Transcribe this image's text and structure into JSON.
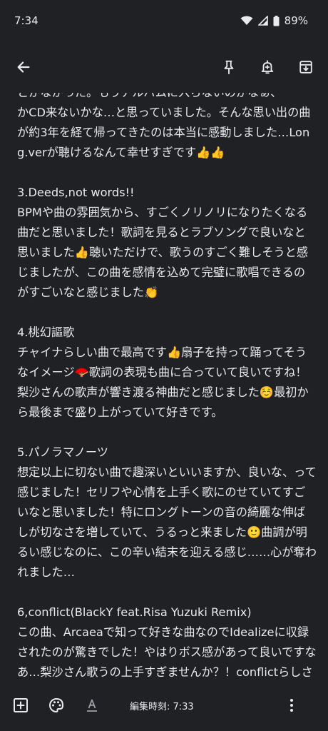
{
  "status": {
    "time": "7:34",
    "battery": "89%"
  },
  "note": {
    "body": "とかなかった。もうアルバムに入らないのかなぁ、\nかCD来ないかな…と思っていました。そんな思い出の曲が約3年を経て帰ってきたのは本当に感動しました…Long.verが聴けるなんて幸せすぎです👍👍\n\n3.Deeds,not words!!\nBPMや曲の雰囲気から、すごくノリノリになりたくなる曲だと思いました！歌詞を見るとラブソングで良いなと思いました👍聴いただけで、歌うのすごく難しそうと感じましたが、この曲を感情を込めて完璧に歌唱できるのがすごいなと感じました👏\n\n4.桃幻謳歌\nチャイナらしい曲で最高です👍扇子を持って踊ってそうなイメージ🪭歌詞の表現も曲に合っていて良いですね！梨沙さんの歌声が響き渡る神曲だと感じました☺️最初から最後まで盛り上がっていて好きです。\n\n5.パノラマノーツ\n想定以上に切ない曲で趣深いといいますか、良いな、って感じました！セリフや心情を上手く歌にのせていてすごいなと思いました！特にロングトーンの音の綺麗な伸ばしが切なさを増していて、うるっと来ました🙂曲調が明るい感じなのに、この辛い結末を迎える感じ……心が奪われました…\n\n6,conflict(BlackY feat.Risa Yuzuki Remix)\nこの曲、Arcaeaで知って好きな曲なのでIdealizeに収録されたのが驚きでした！やはりボス感があって良いですなあ…梨沙さん歌うの上手すぎませんか？！conflictらしさと梨沙さんらしさ両方あって、聴きごたえがあるなと感じました！カッコよすぎー！！！"
  },
  "bottom": {
    "edited": "編集時刻: 7:33"
  },
  "icons": {
    "back": "arrow-back-icon",
    "pin": "pin-icon",
    "reminder": "add-alert-icon",
    "archive": "archive-icon",
    "add": "add-box-icon",
    "palette": "palette-icon",
    "text_format": "text-format-icon",
    "more": "more-vert-icon"
  },
  "colors": {
    "background": "#202124",
    "text": "#e8eaed",
    "icon": "#e8eaed"
  }
}
